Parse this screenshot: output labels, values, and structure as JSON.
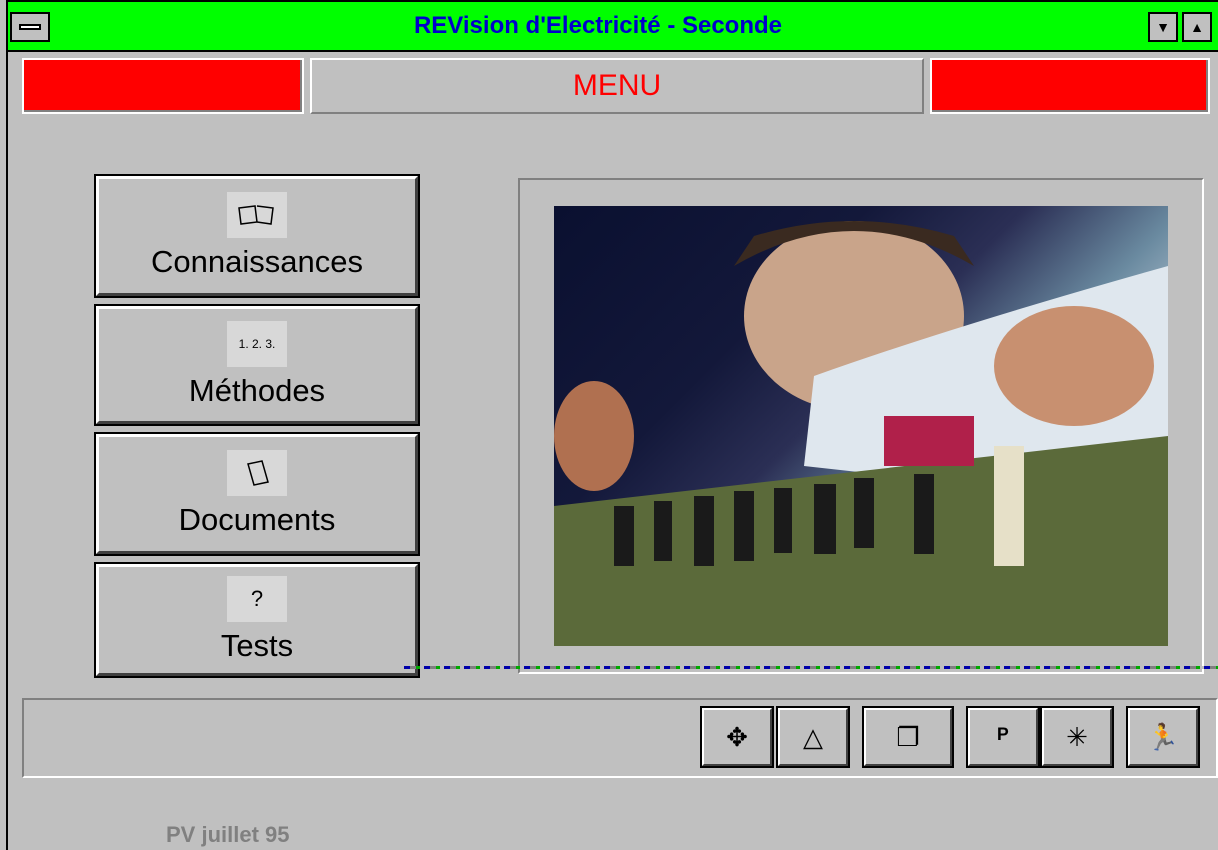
{
  "window": {
    "title": "REVision d'Electricité - Seconde"
  },
  "menu": {
    "title": "MENU"
  },
  "buttons": [
    {
      "label": "Connaissances",
      "icon": "book-icon",
      "glyph": "📖"
    },
    {
      "label": "Méthodes",
      "icon": "numbered-list-icon",
      "glyph": "1. 2. 3."
    },
    {
      "label": "Documents",
      "icon": "document-icon",
      "glyph": "▱"
    },
    {
      "label": "Tests",
      "icon": "question-icon",
      "glyph": "?"
    }
  ],
  "toolbar": {
    "tools": [
      {
        "name": "collapse-tool",
        "glyph": "✥"
      },
      {
        "name": "up-tool",
        "glyph": "△"
      },
      {
        "name": "windows-tool",
        "glyph": "❐"
      },
      {
        "name": "print-tool",
        "glyph": "ᴾ"
      },
      {
        "name": "burst-tool",
        "glyph": "✳"
      },
      {
        "name": "exit-tool",
        "glyph": "🏃"
      }
    ]
  },
  "footer": {
    "text": "PV juillet 95"
  },
  "colors": {
    "titlebar": "#00ff00",
    "title_text": "#0000cc",
    "accent_red": "#ff0000"
  }
}
